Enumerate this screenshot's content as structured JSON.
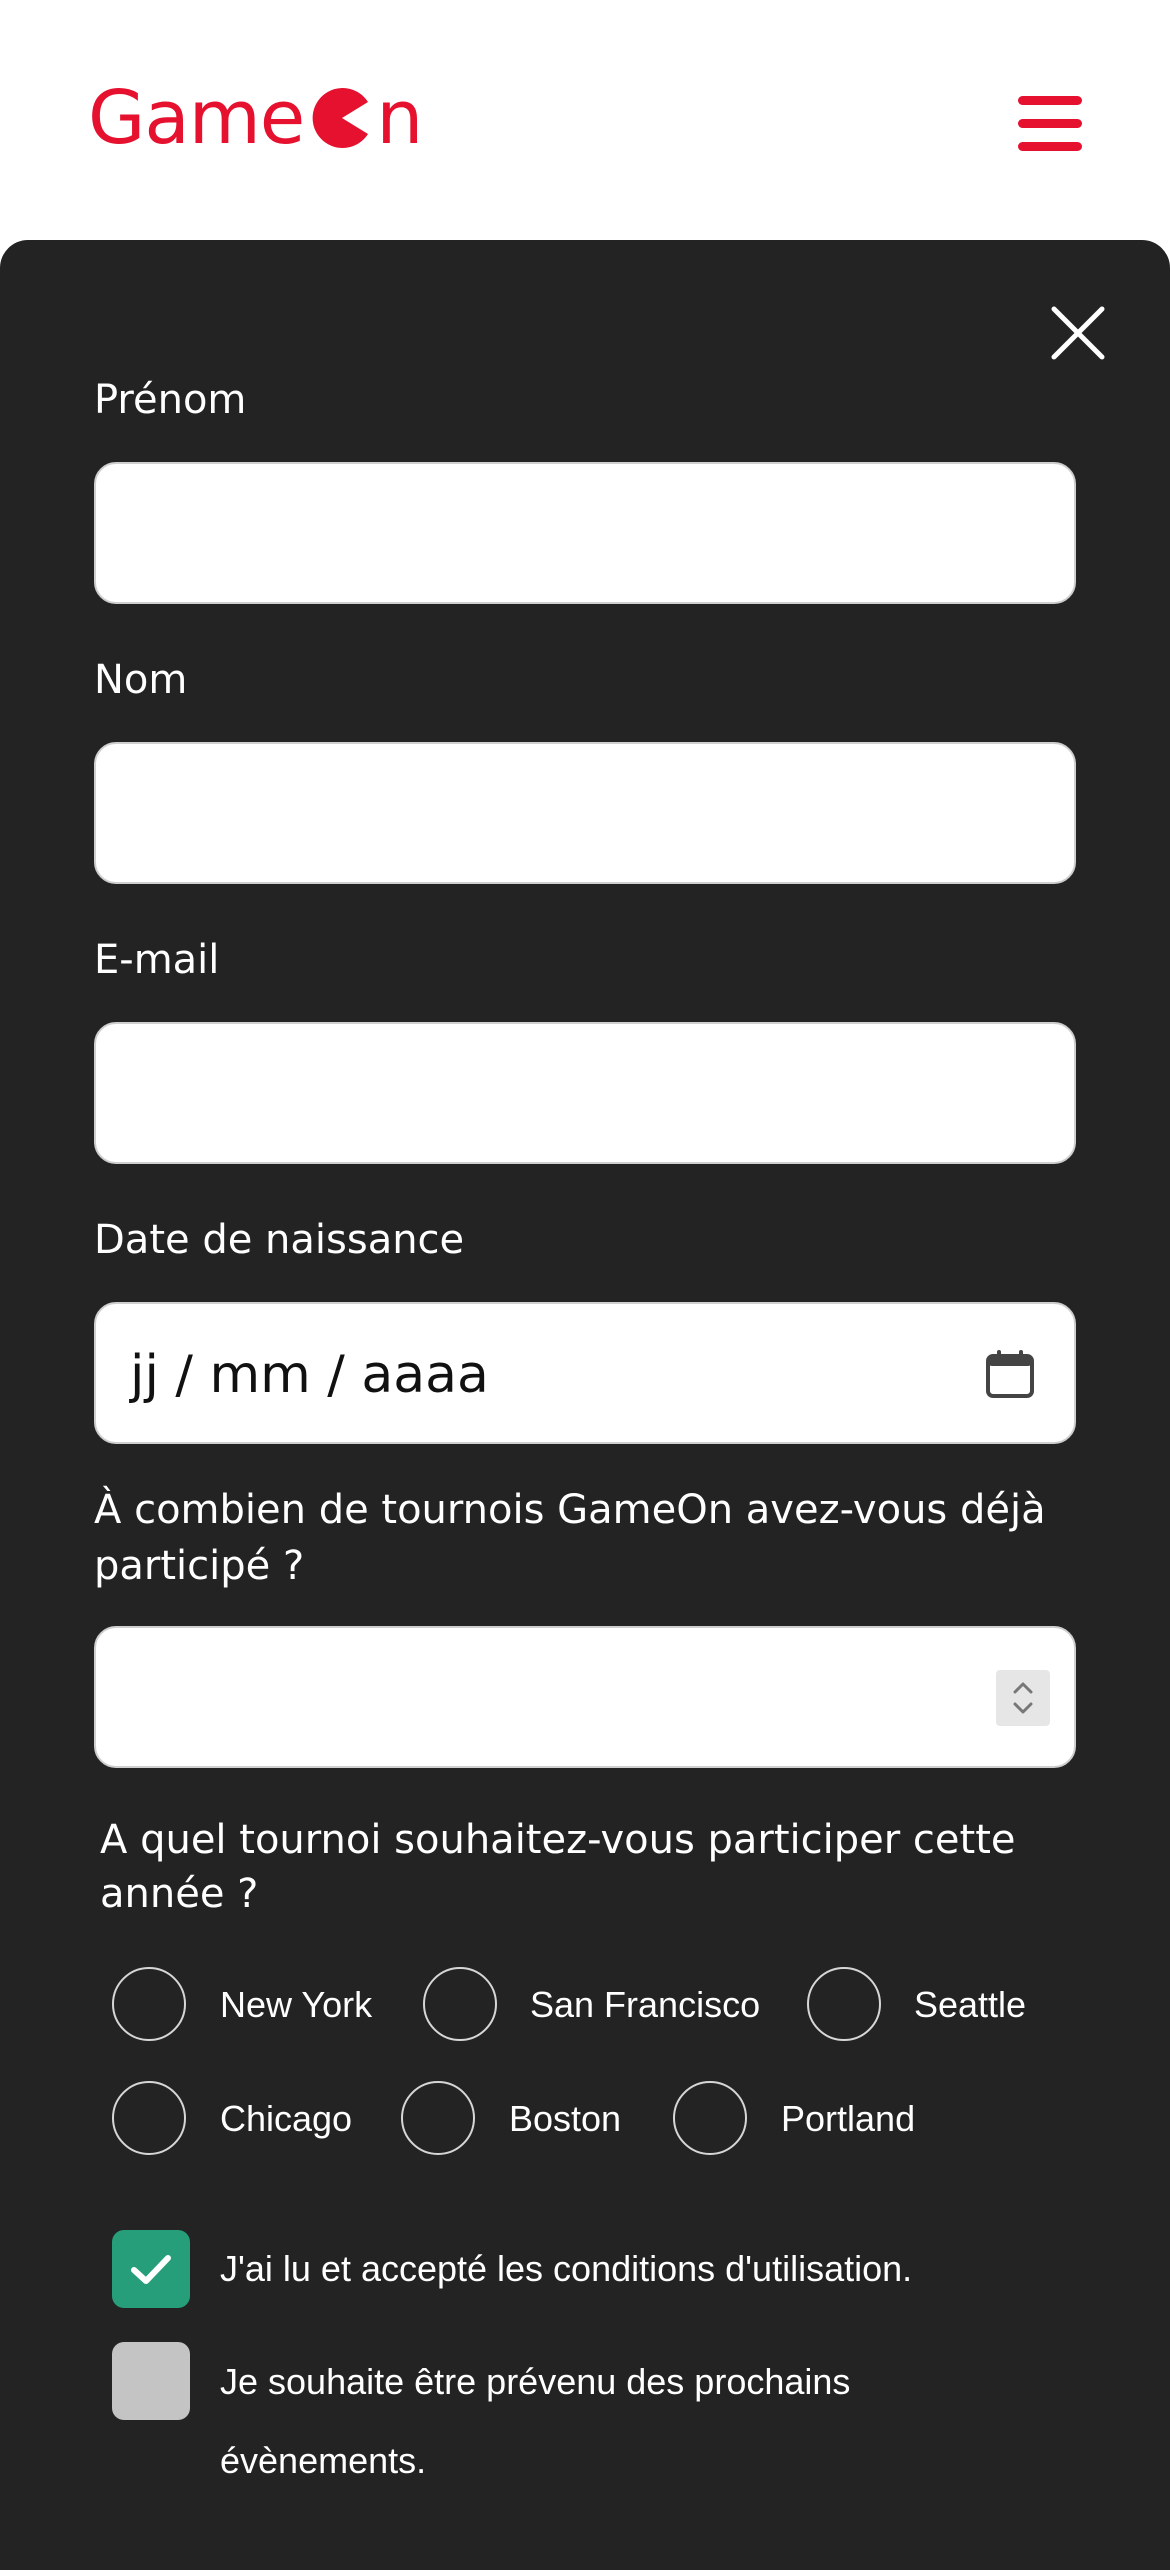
{
  "header": {
    "logo_left": "Game",
    "logo_right": "n",
    "brand_color": "#e5112f"
  },
  "form": {
    "first_name_label": "Prénom",
    "last_name_label": "Nom",
    "email_label": "E-mail",
    "birthdate_label": "Date de naissance",
    "birthdate_placeholder": "jj / mm / aaaa",
    "quantity_label_line1": "À combien de tournois GameOn avez-vous déjà",
    "quantity_label_line2": "participé ?",
    "location_label_line1": "A quel tournoi souhaitez-vous participer cette",
    "location_label_line2": "année ?",
    "locations": [
      "New York",
      "San Francisco",
      "Seattle",
      "Chicago",
      "Boston",
      "Portland"
    ],
    "terms_label": "J'ai lu et accepté les conditions d'utilisation.",
    "terms_checked": true,
    "newsletter_label_line1": "Je souhaite être prévenu des prochains",
    "newsletter_label_line2": "évènements.",
    "newsletter_checked": false
  },
  "colors": {
    "modal_bg": "#232323",
    "checkbox_checked": "#279e7a",
    "checkbox_unchecked": "#c4c4c4"
  }
}
